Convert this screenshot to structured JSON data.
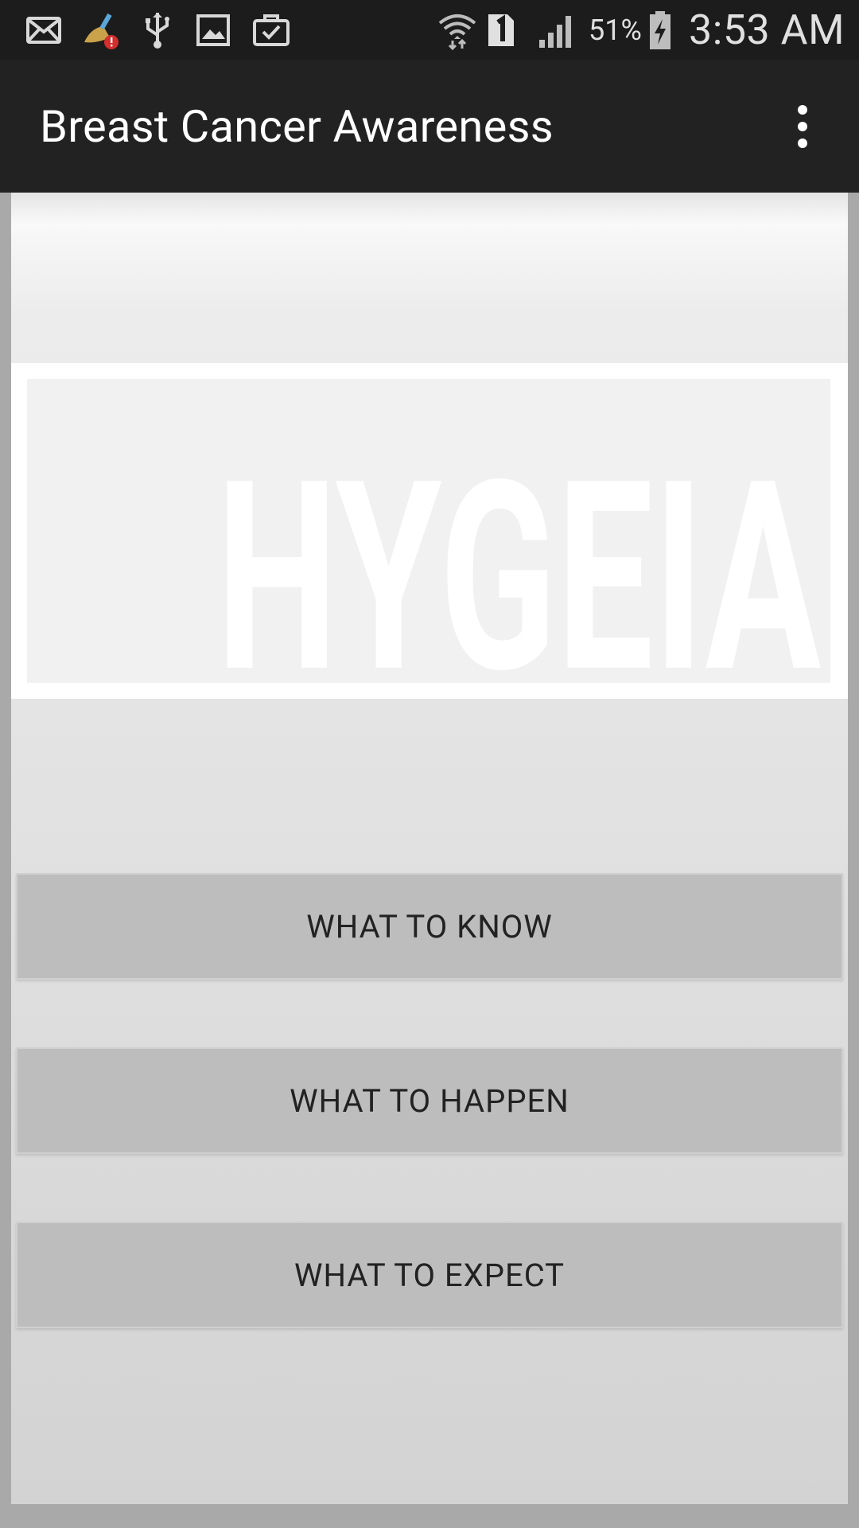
{
  "status_bar": {
    "icons": [
      "mail-icon",
      "cleaner-alert-icon",
      "usb-icon",
      "gallery-icon",
      "briefcase-check-icon",
      "wifi-icon",
      "sim-1-icon",
      "signal-icon",
      "battery-charging-icon"
    ],
    "battery_percent": "51%",
    "time": "3:53 AM"
  },
  "app_bar": {
    "title": "Breast Cancer Awareness",
    "menu_icon": "overflow-menu-icon"
  },
  "logo": {
    "text": "HYGEIA"
  },
  "buttons": {
    "what_to_know": "WHAT TO KNOW",
    "what_to_happen": "WHAT TO HAPPEN",
    "what_to_expect": "WHAT TO EXPECT"
  },
  "colors": {
    "status_bar": "#1c1c1c",
    "app_bar": "#222222",
    "button": "#bdbdbd",
    "frame": "#a9a9a9"
  }
}
